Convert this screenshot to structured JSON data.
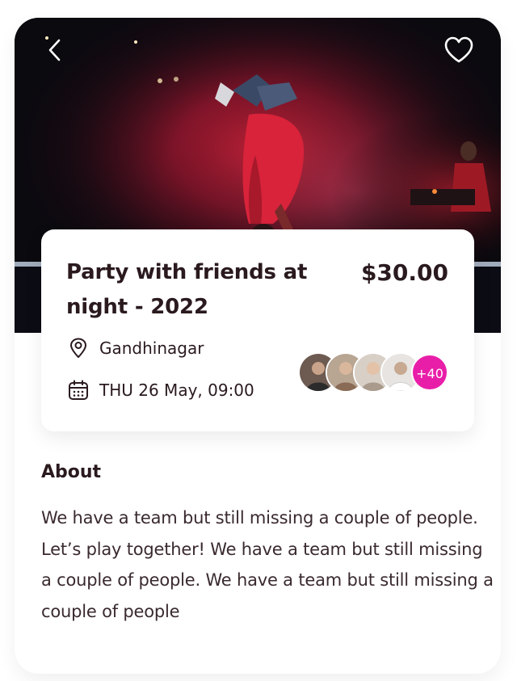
{
  "event": {
    "title": "Party with friends at night - 2022",
    "price": "$30.00",
    "location": "Gandhinagar",
    "datetime": "THU 26 May, 09:00",
    "attendees_extra": "+40"
  },
  "about": {
    "heading": "About",
    "text": "We have a team but still missing a couple of people. Let’s play together! We have a team but still missing a couple of people. We have a team but still missing a couple of people"
  },
  "colors": {
    "accent": "#e91ea8",
    "text_dark": "#2a1a1d"
  },
  "icons": {
    "back": "chevron-left-icon",
    "favorite": "heart-outline-icon",
    "location": "map-pin-icon",
    "calendar": "calendar-icon"
  }
}
